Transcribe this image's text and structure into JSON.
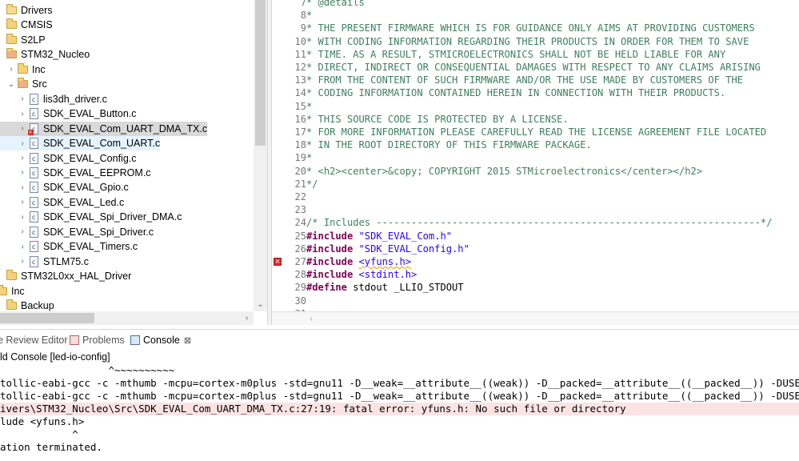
{
  "explorer": {
    "items": [
      {
        "label": "Drivers",
        "type": "folder",
        "expanded": true
      },
      {
        "label": "CMSIS",
        "type": "folder"
      },
      {
        "label": "S2LP",
        "type": "folder"
      },
      {
        "label": "STM32_Nucleo",
        "type": "folder",
        "error": true
      },
      {
        "label": "Inc",
        "type": "folder"
      },
      {
        "label": "Src",
        "type": "folder",
        "expanded": true,
        "error": true
      },
      {
        "label": "lis3dh_driver.c",
        "type": "c-file"
      },
      {
        "label": "SDK_EVAL_Button.c",
        "type": "c-file"
      },
      {
        "label": "SDK_EVAL_Com_UART_DMA_TX.c",
        "type": "c-file",
        "error": true,
        "selected": true
      },
      {
        "label": "SDK_EVAL_Com_UART.c",
        "type": "c-file",
        "hover": true
      },
      {
        "label": "SDK_EVAL_Config.c",
        "type": "c-file"
      },
      {
        "label": "SDK_EVAL_EEPROM.c",
        "type": "c-file"
      },
      {
        "label": "SDK_EVAL_Gpio.c",
        "type": "c-file"
      },
      {
        "label": "SDK_EVAL_Led.c",
        "type": "c-file"
      },
      {
        "label": "SDK_EVAL_Spi_Driver_DMA.c",
        "type": "c-file"
      },
      {
        "label": "SDK_EVAL_Spi_Driver.c",
        "type": "c-file"
      },
      {
        "label": "SDK_EVAL_Timers.c",
        "type": "c-file"
      },
      {
        "label": "STLM75.c",
        "type": "c-file"
      },
      {
        "label": "STM32L0xx_HAL_Driver",
        "type": "folder"
      },
      {
        "label": "Inc",
        "type": "folder"
      },
      {
        "label": "Backup",
        "type": "folder"
      }
    ]
  },
  "editor": {
    "lines": [
      {
        "n": "7",
        "parts": [
          {
            "t": "* @details",
            "c": "com"
          }
        ]
      },
      {
        "n": "8",
        "parts": [
          {
            "t": "*",
            "c": "com"
          }
        ]
      },
      {
        "n": "9",
        "parts": [
          {
            "t": "* THE PRESENT FIRMWARE WHICH IS FOR GUIDANCE ONLY AIMS AT PROVIDING CUSTOMERS",
            "c": "com"
          }
        ]
      },
      {
        "n": "10",
        "parts": [
          {
            "t": "* WITH CODING INFORMATION REGARDING THEIR PRODUCTS IN ORDER FOR THEM TO SAVE",
            "c": "com"
          }
        ]
      },
      {
        "n": "11",
        "parts": [
          {
            "t": "* TIME. AS A RESULT, STMICROELECTRONICS SHALL NOT BE HELD LIABLE FOR ANY",
            "c": "com"
          }
        ]
      },
      {
        "n": "12",
        "parts": [
          {
            "t": "* DIRECT, INDIRECT OR CONSEQUENTIAL DAMAGES WITH RESPECT TO ANY CLAIMS ARISING",
            "c": "com"
          }
        ]
      },
      {
        "n": "13",
        "parts": [
          {
            "t": "* FROM THE CONTENT OF SUCH FIRMWARE AND/OR THE USE MADE BY CUSTOMERS OF THE",
            "c": "com"
          }
        ]
      },
      {
        "n": "14",
        "parts": [
          {
            "t": "* CODING INFORMATION CONTAINED HEREIN IN CONNECTION WITH THEIR PRODUCTS.",
            "c": "com"
          }
        ]
      },
      {
        "n": "15",
        "parts": [
          {
            "t": "*",
            "c": "com"
          }
        ]
      },
      {
        "n": "16",
        "parts": [
          {
            "t": "* THIS SOURCE CODE IS PROTECTED BY A LICENSE.",
            "c": "com"
          }
        ]
      },
      {
        "n": "17",
        "parts": [
          {
            "t": "* FOR MORE INFORMATION PLEASE CAREFULLY READ THE LICENSE AGREEMENT FILE LOCATED",
            "c": "com"
          }
        ]
      },
      {
        "n": "18",
        "parts": [
          {
            "t": "* IN THE ROOT DIRECTORY OF THIS FIRMWARE PACKAGE.",
            "c": "com"
          }
        ]
      },
      {
        "n": "19",
        "parts": [
          {
            "t": "*",
            "c": "com"
          }
        ]
      },
      {
        "n": "20",
        "parts": [
          {
            "t": "* <h2><center>&copy; COPYRIGHT 2015 STMicroelectronics</center></h2>",
            "c": "com"
          }
        ]
      },
      {
        "n": "21",
        "parts": [
          {
            "t": "*/",
            "c": "com"
          }
        ]
      },
      {
        "n": "22",
        "parts": []
      },
      {
        "n": "23",
        "parts": []
      },
      {
        "n": "24",
        "parts": [
          {
            "t": "/* Includes ------------------------------------------------------------------*/",
            "c": "com"
          }
        ]
      },
      {
        "n": "25",
        "parts": [
          {
            "t": "#include",
            "c": "kw"
          },
          {
            "t": " ",
            "c": "plain"
          },
          {
            "t": "\"SDK_EVAL_Com.h\"",
            "c": "str"
          }
        ]
      },
      {
        "n": "26",
        "parts": [
          {
            "t": "#include",
            "c": "kw"
          },
          {
            "t": " ",
            "c": "plain"
          },
          {
            "t": "\"SDK_EVAL_Config.h\"",
            "c": "str"
          }
        ]
      },
      {
        "n": "27",
        "error": true,
        "parts": [
          {
            "t": "#include",
            "c": "kw"
          },
          {
            "t": " ",
            "c": "plain"
          },
          {
            "t": "<yfuns.h>",
            "c": "str squiggle"
          }
        ]
      },
      {
        "n": "28",
        "parts": [
          {
            "t": "#include",
            "c": "kw"
          },
          {
            "t": " ",
            "c": "plain"
          },
          {
            "t": "<stdint.h>",
            "c": "str"
          }
        ]
      },
      {
        "n": "29",
        "parts": [
          {
            "t": "#define",
            "c": "kw"
          },
          {
            "t": " stdout _LLIO_STDOUT",
            "c": "plain"
          }
        ]
      },
      {
        "n": "30",
        "parts": []
      },
      {
        "n": "31",
        "parts": []
      }
    ]
  },
  "panel": {
    "tabs": [
      {
        "label": "e Review Editor",
        "icon": "review-editor-icon"
      },
      {
        "label": "Problems",
        "icon": "problems-icon"
      },
      {
        "label": "Console",
        "icon": "console-icon",
        "active": true,
        "close": "⊠"
      }
    ],
    "console_title": "ld Console [led-io-config]",
    "console_lines": [
      {
        "text": "                  ^~~~~~~~~~~"
      },
      {
        "text": "tollic-eabi-gcc -c -mthumb -mcpu=cortex-m0plus -std=gnu11 -D__weak=__attribute__((weak)) -D__packed=__attribute__((__packed__)) -DUSE_HAL_D"
      },
      {
        "text": "tollic-eabi-gcc -c -mthumb -mcpu=cortex-m0plus -std=gnu11 -D__weak=__attribute__((weak)) -D__packed=__attribute__((__packed__)) -DUSE_HAL_D"
      },
      {
        "text": "ivers\\STM32_Nucleo\\Src\\SDK_EVAL_Com_UART_DMA_TX.c:27:19: fatal error: yfuns.h: No such file or directory",
        "error": true
      },
      {
        "text": "lude <yfuns.h>"
      },
      {
        "text": "            ^"
      },
      {
        "text": "ation terminated."
      }
    ]
  },
  "colors": {
    "keyword": "#7f0055",
    "string": "#2a00ff",
    "comment": "#3f7f5f",
    "error": "#d0312d",
    "error_row_bg": "#fbe3e4",
    "selection": "#d9d9d9"
  }
}
